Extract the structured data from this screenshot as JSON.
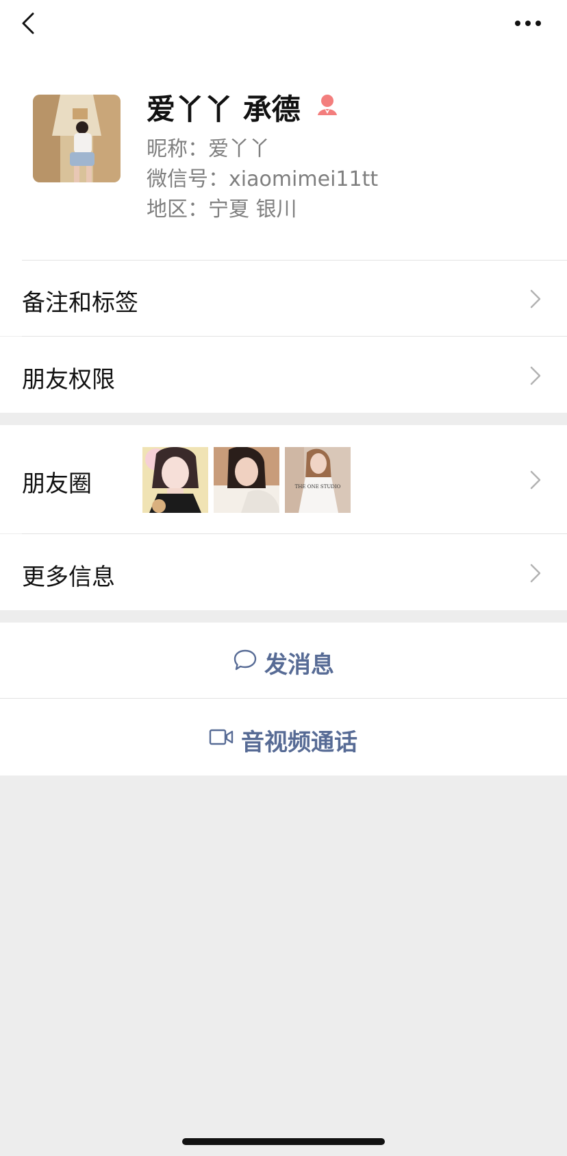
{
  "profile": {
    "display_name": "爱丫丫 承德",
    "nickname": "昵称：爱丫丫",
    "wechat_id": "微信号：xiaomimei11tt",
    "region": "地区：宁夏 银川"
  },
  "rows": {
    "remarks": "备注和标签",
    "permissions": "朋友权限",
    "moments": "朋友圈",
    "more_info": "更多信息"
  },
  "moments_photos": {
    "photo3_caption": "THE ONE STUDIO"
  },
  "actions": {
    "message": "发消息",
    "call": "音视频通话"
  },
  "icons": {
    "back": "chevron-left-icon",
    "more": "more-dots-icon",
    "gender": "female-icon",
    "message": "chat-bubble-icon",
    "call": "video-camera-icon"
  },
  "colors": {
    "accent": "#576b95",
    "female": "#f37e7d",
    "background": "#ededed"
  }
}
